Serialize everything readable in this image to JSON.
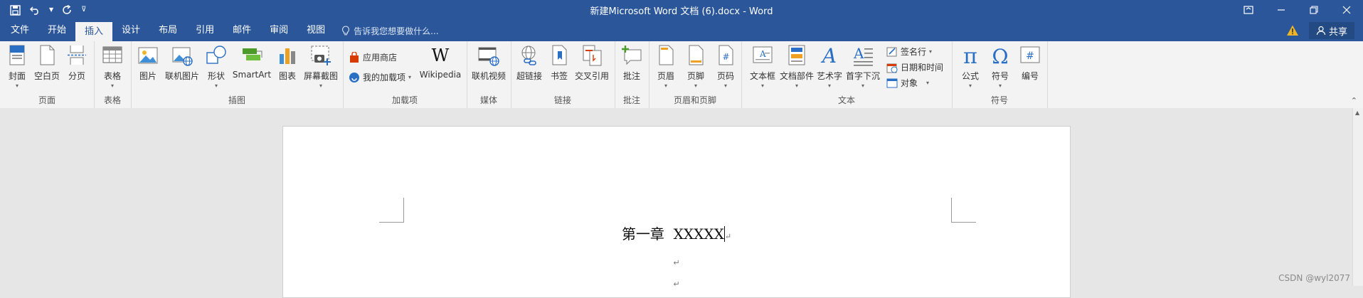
{
  "title": "新建Microsoft Word 文档 (6).docx - Word",
  "qat": {
    "save_icon": "save-icon",
    "undo_icon": "undo-icon",
    "redo_icon": "redo-icon",
    "customize_icon": "customize-qat-icon"
  },
  "tabs": [
    {
      "label": "文件"
    },
    {
      "label": "开始"
    },
    {
      "label": "插入",
      "active": true
    },
    {
      "label": "设计"
    },
    {
      "label": "布局"
    },
    {
      "label": "引用"
    },
    {
      "label": "邮件"
    },
    {
      "label": "审阅"
    },
    {
      "label": "视图"
    }
  ],
  "tell_me": "告诉我您想要做什么...",
  "share": "共享",
  "ribbon": {
    "pages": {
      "label": "页面",
      "cover": "封面",
      "blank": "空白页",
      "break": "分页"
    },
    "tables": {
      "label": "表格",
      "table": "表格"
    },
    "illustrations": {
      "label": "插图",
      "picture": "图片",
      "online_picture": "联机图片",
      "shapes": "形状",
      "smartart": "SmartArt",
      "chart": "图表",
      "screenshot": "屏幕截图"
    },
    "addins": {
      "label": "加载项",
      "store": "应用商店",
      "my_addins": "我的加载项",
      "wikipedia": "Wikipedia"
    },
    "media": {
      "label": "媒体",
      "online_video": "联机视频"
    },
    "links": {
      "label": "链接",
      "hyperlink": "超链接",
      "bookmark": "书签",
      "cross_ref": "交叉引用"
    },
    "comments": {
      "label": "批注",
      "comment": "批注"
    },
    "header_footer": {
      "label": "页眉和页脚",
      "header": "页眉",
      "footer": "页脚",
      "page_number": "页码"
    },
    "text": {
      "label": "文本",
      "textbox": "文本框",
      "quick_parts": "文档部件",
      "wordart": "艺术字",
      "dropcap": "首字下沉",
      "signature": "签名行",
      "datetime": "日期和时间",
      "object": "对象"
    },
    "symbols": {
      "label": "符号",
      "equation": "公式",
      "symbol": "符号",
      "number": "编号"
    }
  },
  "document": {
    "heading": "第一章  XXXXX",
    "para_mark": "↵"
  },
  "watermark": "CSDN @wyl2077",
  "colors": {
    "accent": "#2b579a",
    "ribbon_bg": "#f3f3f3",
    "doc_bg": "#e6e6e6"
  }
}
